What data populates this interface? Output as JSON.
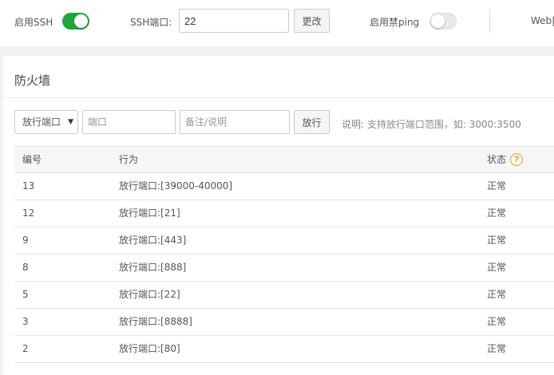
{
  "ssh": {
    "enable_label": "启用SSH",
    "enabled": true,
    "port_label": "SSH端口:",
    "port_value": "22",
    "change_button": "更改"
  },
  "ping": {
    "label": "启用禁ping",
    "enabled": false
  },
  "web_label": "Web|",
  "colors": {
    "toggle_on": "#20a53a",
    "help_icon": "#f39c12"
  },
  "firewall": {
    "title": "防火墙",
    "select_value": "放行端口",
    "port_placeholder": "端口",
    "remark_placeholder": "备注/说明",
    "allow_button": "放行",
    "hint": "说明: 支持放行端口范围，如: 3000:3500",
    "columns": [
      "编号",
      "行为",
      "状态"
    ],
    "rows": [
      {
        "id": "13",
        "action": "放行端口:[39000-40000]",
        "status": "正常"
      },
      {
        "id": "12",
        "action": "放行端口:[21]",
        "status": "正常"
      },
      {
        "id": "9",
        "action": "放行端口:[443]",
        "status": "正常"
      },
      {
        "id": "8",
        "action": "放行端口:[888]",
        "status": "正常"
      },
      {
        "id": "5",
        "action": "放行端口:[22]",
        "status": "正常"
      },
      {
        "id": "3",
        "action": "放行端口:[8888]",
        "status": "正常"
      },
      {
        "id": "2",
        "action": "放行端口:[80]",
        "status": "正常"
      }
    ]
  }
}
